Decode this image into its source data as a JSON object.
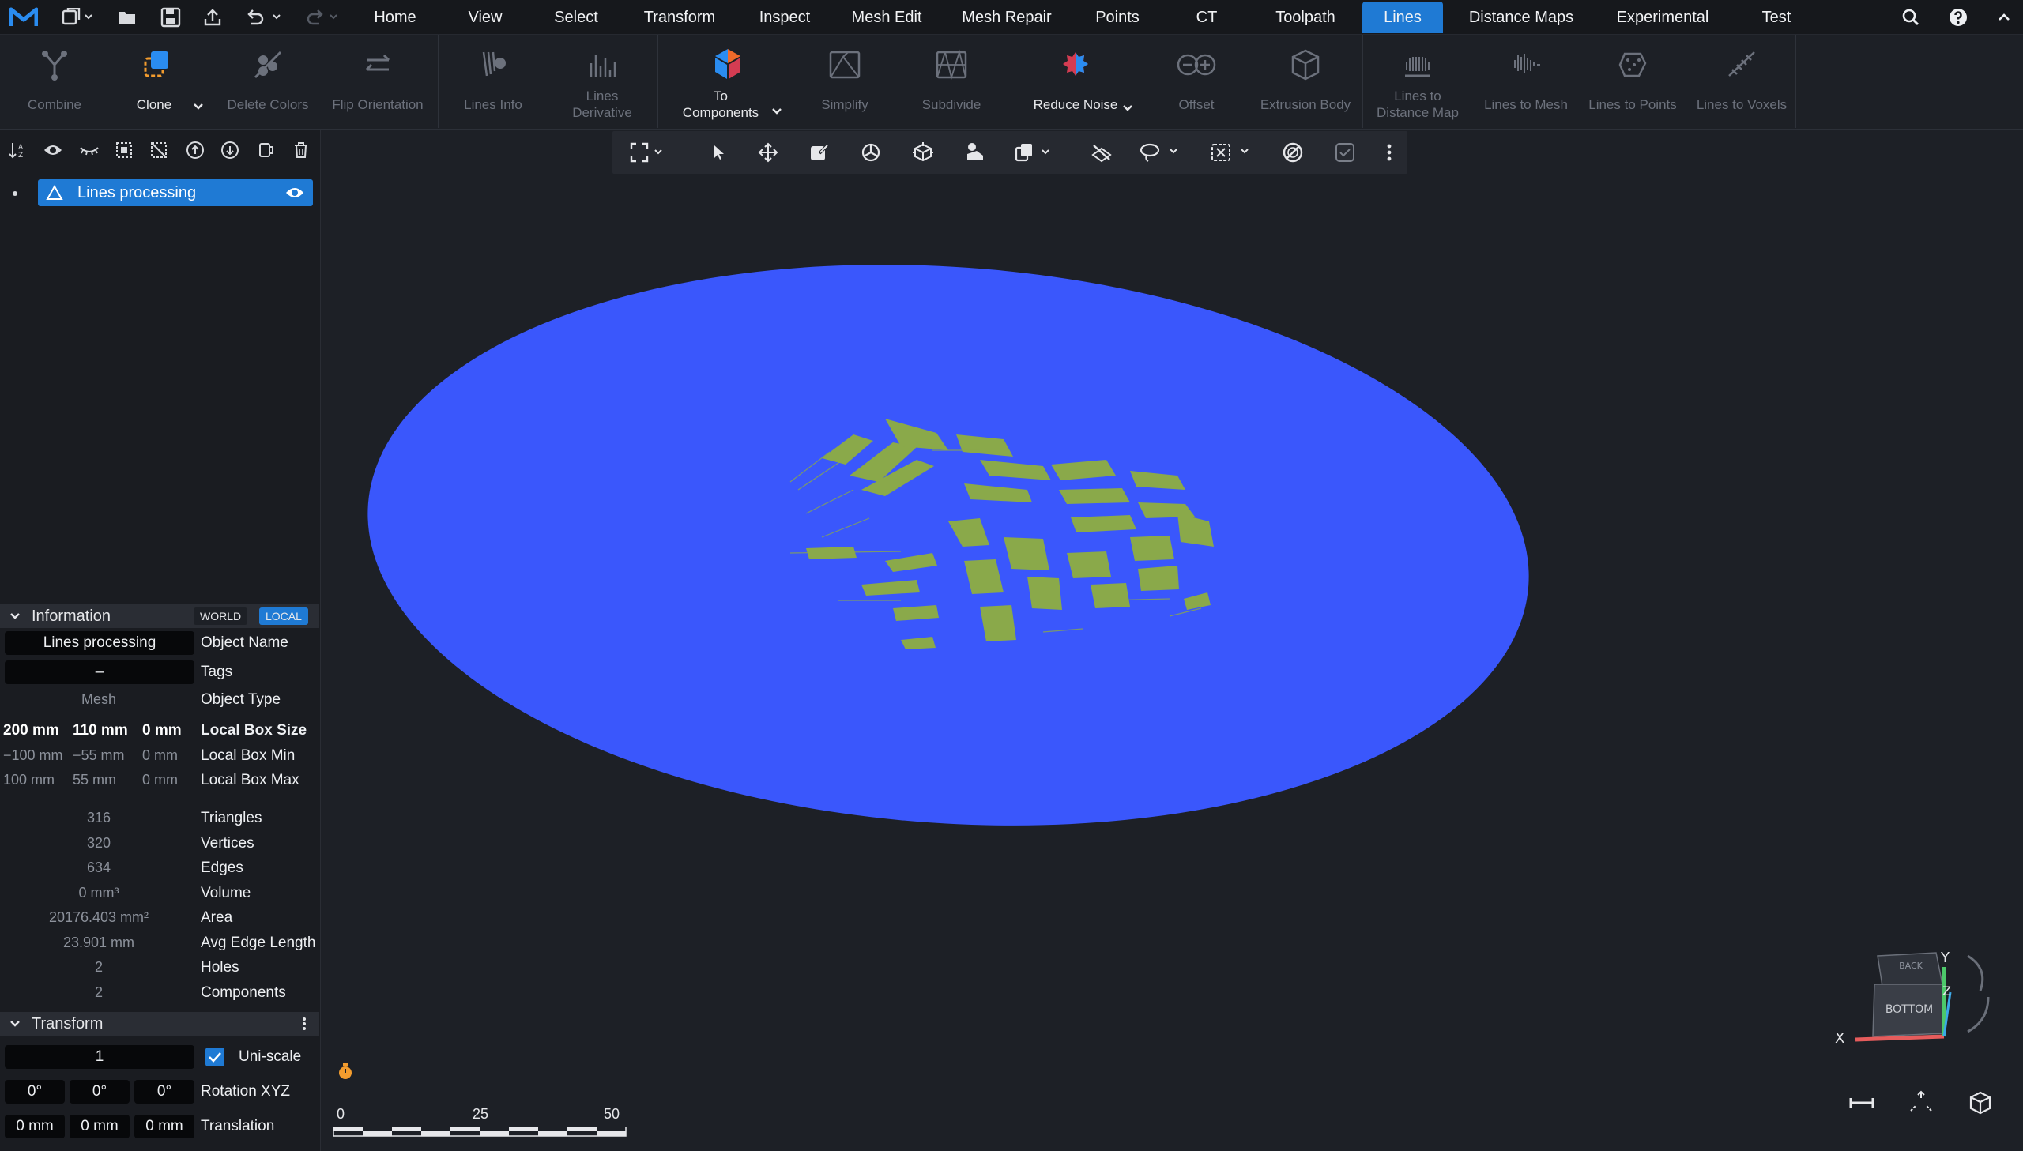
{
  "menu": {
    "tabs": [
      "Home",
      "View",
      "Select",
      "Transform",
      "Inspect",
      "Mesh Edit",
      "Mesh Repair",
      "Points",
      "CT",
      "Toolpath",
      "Lines",
      "Distance Maps",
      "Experimental",
      "Test"
    ],
    "active_tab": "Lines"
  },
  "ribbon": {
    "combine": "Combine",
    "clone": "Clone",
    "delete_colors": "Delete Colors",
    "flip_orientation": "Flip Orientation",
    "lines_info": "Lines Info",
    "lines_derivative": [
      "Lines",
      "Derivative"
    ],
    "to_components": [
      "To",
      "Components"
    ],
    "simplify": "Simplify",
    "subdivide": "Subdivide",
    "reduce_noise": "Reduce Noise",
    "offset": "Offset",
    "extrusion_body": "Extrusion Body",
    "lines_to_distance_map": [
      "Lines to",
      "Distance Map"
    ],
    "lines_to_mesh": "Lines to Mesh",
    "lines_to_points": "Lines to Points",
    "lines_to_voxels": "Lines to Voxels"
  },
  "scene": {
    "object_name": "Lines processing"
  },
  "information": {
    "title": "Information",
    "world": "WORLD",
    "local": "LOCAL",
    "object_name": {
      "value": "Lines processing",
      "label": "Object Name"
    },
    "tags": {
      "value": "–",
      "label": "Tags"
    },
    "object_type": {
      "value": "Mesh",
      "label": "Object Type"
    },
    "local_box_size": {
      "x": "200 mm",
      "y": "110 mm",
      "z": "0 mm",
      "label": "Local Box Size"
    },
    "local_box_min": {
      "x": "−100 mm",
      "y": "−55 mm",
      "z": "0 mm",
      "label": "Local Box Min"
    },
    "local_box_max": {
      "x": "100 mm",
      "y": "55 mm",
      "z": "0 mm",
      "label": "Local Box Max"
    },
    "triangles": {
      "value": "316",
      "label": "Triangles"
    },
    "vertices": {
      "value": "320",
      "label": "Vertices"
    },
    "edges": {
      "value": "634",
      "label": "Edges"
    },
    "volume": {
      "value": "0 mm³",
      "label": "Volume"
    },
    "area": {
      "value": "20176.403 mm²",
      "label": "Area"
    },
    "avg_edge_length": {
      "value": "23.901 mm",
      "label": "Avg Edge Length"
    },
    "holes": {
      "value": "2",
      "label": "Holes"
    },
    "components": {
      "value": "2",
      "label": "Components"
    }
  },
  "transform": {
    "title": "Transform",
    "scale": "1",
    "uni_scale": "Uni-scale",
    "rotation": {
      "x": "0°",
      "y": "0°",
      "z": "0°",
      "label": "Rotation XYZ"
    },
    "translation": {
      "x": "0 mm",
      "y": "0 mm",
      "z": "0 mm",
      "label": "Translation"
    }
  },
  "scale_bar": {
    "t0": "0",
    "t1": "25",
    "t2": "50"
  },
  "view_cube": {
    "back": "BACK",
    "bottom": "BOTTOM",
    "x": "X",
    "y": "Y",
    "z": "Z"
  },
  "colors": {
    "accent": "#1f7ad4",
    "mesh": "#3a57fc",
    "lines": "#8aa94a"
  }
}
